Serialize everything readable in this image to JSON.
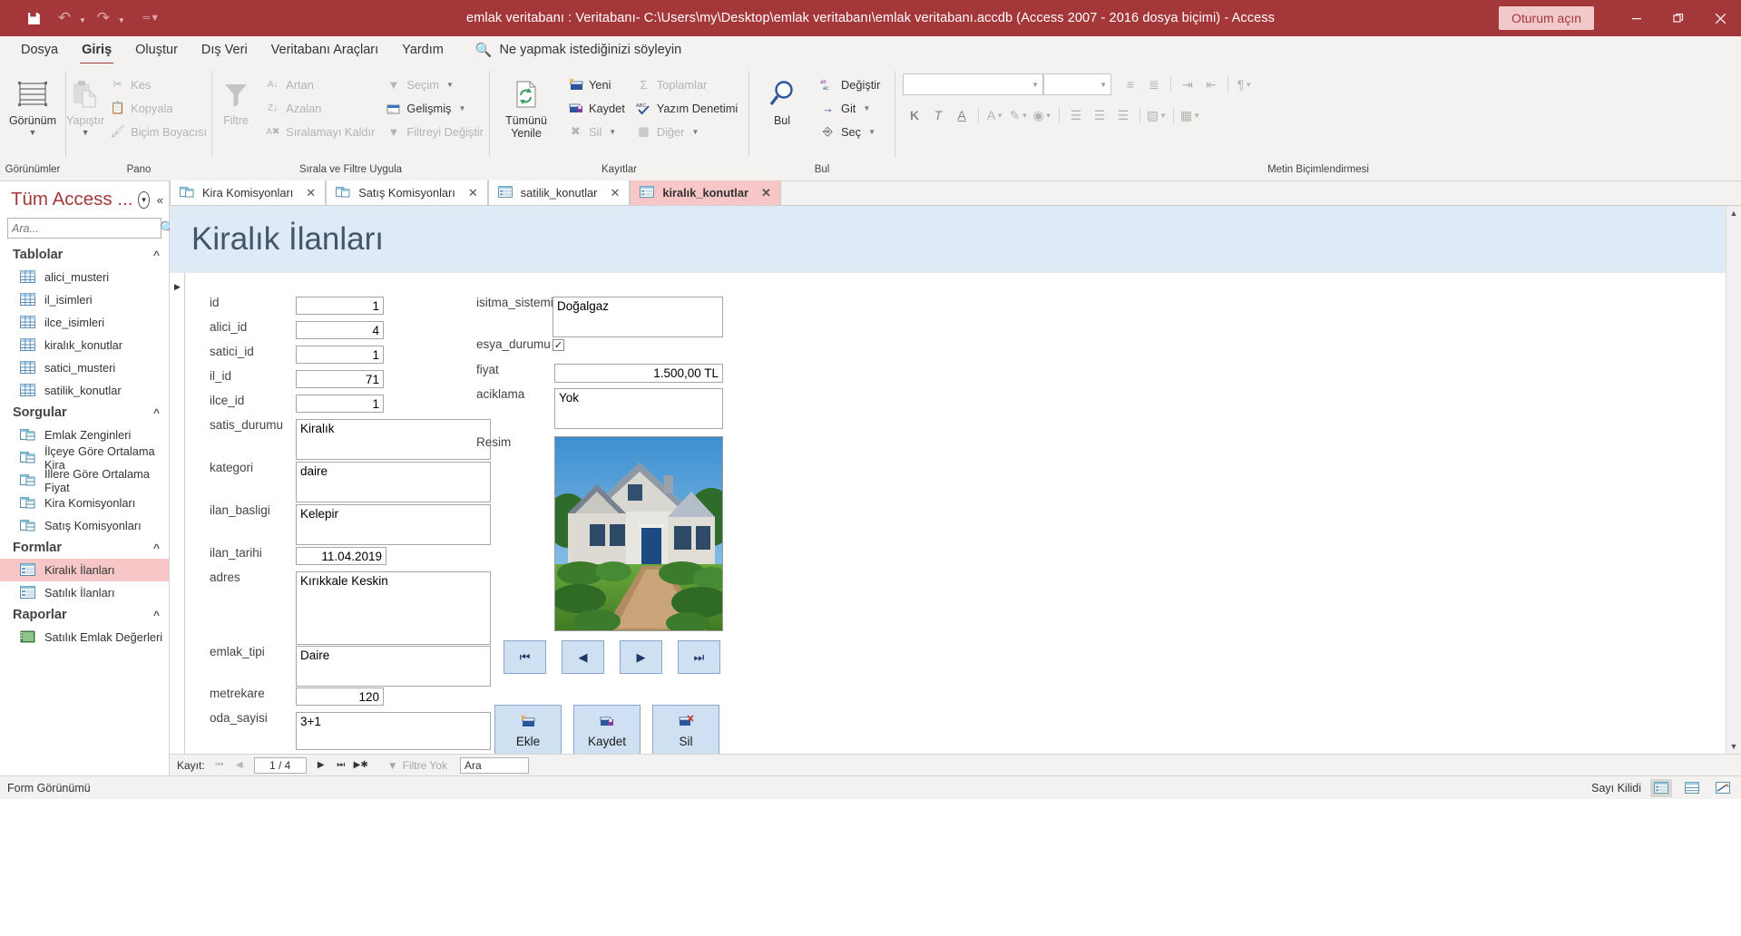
{
  "titlebar": {
    "title": "emlak veritabanı : Veritabanı- C:\\Users\\my\\Desktop\\emlak veritabanı\\emlak veritabanı.accdb (Access 2007 - 2016 dosya biçimi)  -  Access",
    "signin_label": "Oturum açın",
    "qat": [
      {
        "name": "save-icon",
        "glyph": "💾"
      },
      {
        "name": "undo-icon",
        "glyph": "↶"
      },
      {
        "name": "redo-icon",
        "glyph": "↷"
      },
      {
        "name": "customize-qat-icon",
        "glyph": "☰"
      }
    ],
    "window_controls": [
      "minimize",
      "restore",
      "close"
    ]
  },
  "menubar": {
    "tabs": [
      {
        "label": "Dosya",
        "active": false
      },
      {
        "label": "Giriş",
        "active": true
      },
      {
        "label": "Oluştur",
        "active": false
      },
      {
        "label": "Dış Veri",
        "active": false
      },
      {
        "label": "Veritabanı Araçları",
        "active": false
      },
      {
        "label": "Yardım",
        "active": false
      }
    ],
    "tell_me": "Ne yapmak istediğinizi söyleyin"
  },
  "ribbon": {
    "groups": [
      {
        "label": "Görünümler"
      },
      {
        "label": "Pano"
      },
      {
        "label": "Sırala ve Filtre Uygula"
      },
      {
        "label": "Kayıtlar"
      },
      {
        "label": "Bul"
      },
      {
        "label": "Metin Biçimlendirmesi"
      }
    ],
    "views": {
      "big_label": "Görünüm"
    },
    "clipboard": {
      "big_label": "Yapıştır",
      "items": [
        {
          "label": "Kes",
          "icon": "scissors-icon",
          "disabled": true
        },
        {
          "label": "Kopyala",
          "icon": "copy-icon",
          "disabled": true
        },
        {
          "label": "Biçim Boyacısı",
          "icon": "format-painter-icon",
          "disabled": true
        }
      ]
    },
    "sortfilter": {
      "big_label": "Filtre",
      "items": [
        {
          "label": "Artan",
          "icon": "sort-ascending-icon",
          "disabled": true
        },
        {
          "label": "Azalan",
          "icon": "sort-descending-icon",
          "disabled": true
        },
        {
          "label": "Sıralamayı Kaldır",
          "icon": "clear-sort-icon",
          "disabled": true
        },
        {
          "label": "Seçim",
          "icon": "selection-filter-icon",
          "disabled": true
        },
        {
          "label": "Gelişmiş",
          "icon": "advanced-filter-icon",
          "disabled": false
        },
        {
          "label": "Filtreyi Değiştir",
          "icon": "toggle-filter-icon",
          "disabled": true
        }
      ]
    },
    "records": {
      "big_label": "Tümünü Yenile",
      "items": [
        {
          "label": "Yeni",
          "icon": "new-record-icon",
          "disabled": false
        },
        {
          "label": "Kaydet",
          "icon": "save-record-icon",
          "disabled": false
        },
        {
          "label": "Sil",
          "icon": "delete-record-icon",
          "disabled": true
        },
        {
          "label": "Toplamlar",
          "icon": "totals-icon",
          "disabled": true
        },
        {
          "label": "Yazım Denetimi",
          "icon": "spelling-icon",
          "disabled": false
        },
        {
          "label": "Diğer",
          "icon": "more-icon",
          "disabled": true
        }
      ]
    },
    "find": {
      "big_label": "Bul",
      "items": [
        {
          "label": "Değiştir",
          "icon": "replace-icon",
          "disabled": false
        },
        {
          "label": "Git",
          "icon": "goto-icon",
          "disabled": false
        },
        {
          "label": "Seç",
          "icon": "select-icon",
          "disabled": false
        }
      ]
    },
    "textformat": {
      "font_value": "",
      "size_value": "",
      "buttons": [
        "K",
        "T",
        "A"
      ]
    }
  },
  "navpane": {
    "title": "Tüm Access ...",
    "search_placeholder": "Ara...",
    "search_value": "",
    "groups": [
      {
        "label": "Tablolar",
        "icon": "table-icon",
        "items": [
          {
            "label": "alici_musteri",
            "selected": false
          },
          {
            "label": "il_isimleri",
            "selected": false
          },
          {
            "label": "ilce_isimleri",
            "selected": false
          },
          {
            "label": "kiralık_konutlar",
            "selected": false
          },
          {
            "label": "satici_musteri",
            "selected": false
          },
          {
            "label": "satilik_konutlar",
            "selected": false
          }
        ]
      },
      {
        "label": "Sorgular",
        "icon": "query-icon",
        "items": [
          {
            "label": "Emlak Zenginleri",
            "selected": false
          },
          {
            "label": "İlçeye Göre Ortalama Kira",
            "selected": false
          },
          {
            "label": "İllere Göre Ortalama Fiyat",
            "selected": false
          },
          {
            "label": "Kira Komisyonları",
            "selected": false
          },
          {
            "label": "Satış Komisyonları",
            "selected": false
          }
        ]
      },
      {
        "label": "Formlar",
        "icon": "form-icon",
        "items": [
          {
            "label": "Kiralık İlanları",
            "selected": true
          },
          {
            "label": "Satılık İlanları",
            "selected": false
          }
        ]
      },
      {
        "label": "Raporlar",
        "icon": "report-icon",
        "items": [
          {
            "label": "Satılık Emlak Değerleri",
            "selected": false
          }
        ]
      }
    ]
  },
  "doctabs": [
    {
      "label": "Kira Komisyonları",
      "icon": "query-icon",
      "active": false
    },
    {
      "label": "Satış Komisyonları",
      "icon": "query-icon",
      "active": false
    },
    {
      "label": "satilik_konutlar",
      "icon": "form-icon",
      "active": false
    },
    {
      "label": "kiralık_konutlar",
      "icon": "form-icon",
      "active": true
    }
  ],
  "form": {
    "title": "Kiralık İlanları",
    "fields_left": [
      {
        "label": "id",
        "value": "1",
        "type": "number"
      },
      {
        "label": "alici_id",
        "value": "4",
        "type": "number"
      },
      {
        "label": "satici_id",
        "value": "1",
        "type": "number"
      },
      {
        "label": "il_id",
        "value": "71",
        "type": "number"
      },
      {
        "label": "ilce_id",
        "value": "1",
        "type": "number"
      },
      {
        "label": "satis_durumu",
        "value": "Kiralık",
        "type": "memo"
      },
      {
        "label": "kategori",
        "value": "daire",
        "type": "memo"
      },
      {
        "label": "ilan_basligi",
        "value": "Kelepir",
        "type": "memo"
      },
      {
        "label": "ilan_tarihi",
        "value": "11.04.2019",
        "type": "date"
      },
      {
        "label": "adres",
        "value": "Kırıkkale Keskin",
        "type": "memo-tall"
      },
      {
        "label": "emlak_tipi",
        "value": "Daire",
        "type": "memo"
      },
      {
        "label": "metrekare",
        "value": "120",
        "type": "number"
      },
      {
        "label": "oda_sayisi",
        "value": "3+1",
        "type": "memo"
      }
    ],
    "fields_right": [
      {
        "label": "isitma_sistemi",
        "value": "Doğalgaz",
        "type": "memo"
      },
      {
        "label": "esya_durumu",
        "value": "checked",
        "type": "checkbox"
      },
      {
        "label": "fiyat",
        "value": "1.500,00 TL",
        "type": "number"
      },
      {
        "label": "aciklama",
        "value": "Yok",
        "type": "memo"
      },
      {
        "label": "Resim",
        "value": "house-photo",
        "type": "image"
      }
    ],
    "nav_buttons": [
      {
        "name": "first-record-button",
        "glyph": "⏮"
      },
      {
        "name": "previous-record-button",
        "glyph": "◀"
      },
      {
        "name": "next-record-button",
        "glyph": "▶"
      },
      {
        "name": "last-record-button",
        "glyph": "⏭"
      }
    ],
    "command_buttons": [
      {
        "name": "add-button",
        "label": "Ekle",
        "icon": "add-record-icon"
      },
      {
        "name": "save-button",
        "label": "Kaydet",
        "icon": "save-record-icon"
      },
      {
        "name": "delete-button",
        "label": "Sil",
        "icon": "delete-record-icon"
      }
    ]
  },
  "recordnav": {
    "label": "Kayıt:",
    "position": "1 / 4",
    "filter_label": "Filtre Yok",
    "search_value": "Ara"
  },
  "statusbar": {
    "view_label": "Form Görünümü",
    "num_lock": "Sayı Kilidi",
    "views": [
      {
        "name": "form-view-button",
        "active": true
      },
      {
        "name": "layout-view-button",
        "active": false
      },
      {
        "name": "design-view-button",
        "active": false
      }
    ]
  },
  "colors": {
    "accent": "#a4373a",
    "form_header_bg": "#deeaf6",
    "form_title": "#44546a",
    "button_bg": "#cfe0f3",
    "selected_nav": "#f7c6c7"
  }
}
